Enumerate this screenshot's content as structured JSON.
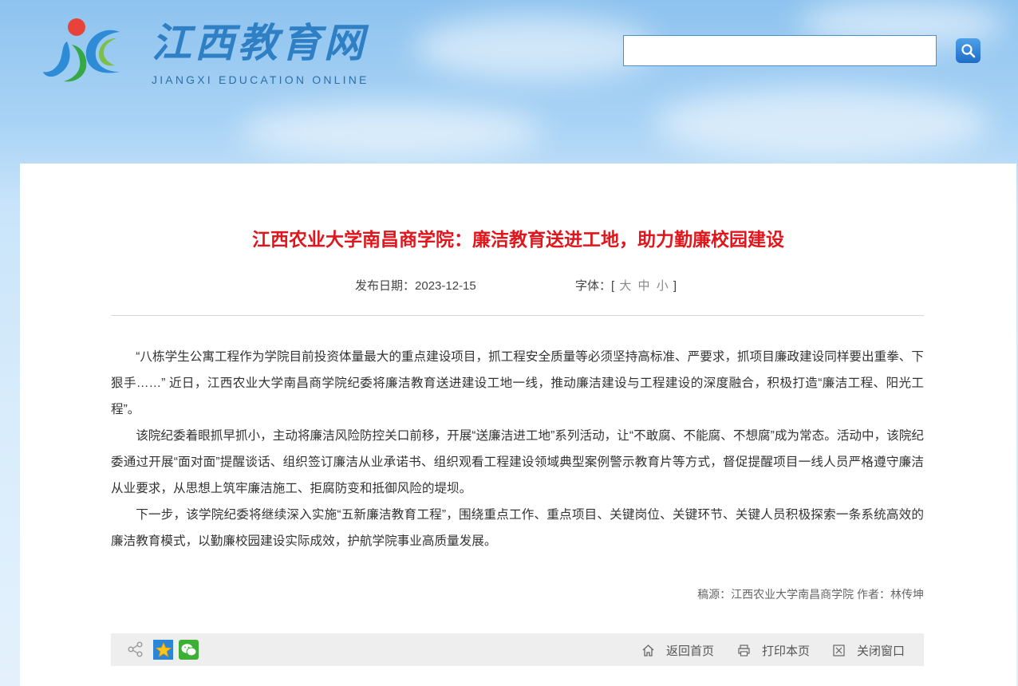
{
  "header": {
    "logo_cn": "江西教育网",
    "logo_en": "JIANGXI EDUCATION ONLINE",
    "search": {
      "value": "",
      "placeholder": ""
    }
  },
  "article": {
    "title": "江西农业大学南昌商学院：廉洁教育送进工地，助力勤廉校园建设",
    "date_label": "发布日期：",
    "date": "2023-12-15",
    "font_label": "字体：[",
    "font_sizes": [
      "大",
      "中",
      "小"
    ],
    "font_close": "]",
    "paragraphs": [
      "“八栋学生公寓工程作为学院目前投资体量最大的重点建设项目，抓工程安全质量等必须坚持高标准、严要求，抓项目廉政建设同样要出重拳、下狠手……” 近日，江西农业大学南昌商学院纪委将廉洁教育送进建设工地一线，推动廉洁建设与工程建设的深度融合，积极打造“廉洁工程、阳光工程”。",
      "该院纪委着眼抓早抓小，主动将廉洁风险防控关口前移，开展“送廉洁进工地”系列活动，让“不敢腐、不能腐、不想腐”成为常态。活动中，该院纪委通过开展“面对面”提醒谈话、组织签订廉洁从业承诺书、组织观看工程建设领域典型案例警示教育片等方式，督促提醒项目一线人员严格遵守廉洁从业要求，从思想上筑牢廉洁施工、拒腐防变和抵御风险的堤坝。",
      "下一步，该学院纪委将继续深入实施“五新廉洁教育工程”，围绕重点工作、重点项目、关键岗位、关键环节、关键人员积极探索一条系统高效的廉洁教育模式，以勤廉校园建设实际成效，护航学院事业高质量发展。"
    ],
    "source": "稿源：江西农业大学南昌商学院 作者：林传坤"
  },
  "toolbar": {
    "home": "返回首页",
    "print": "打印本页",
    "close": "关闭窗口"
  },
  "colors": {
    "title": "#e0161c",
    "accent_blue": "#2f7fc4",
    "wechat": "#3cb034"
  }
}
